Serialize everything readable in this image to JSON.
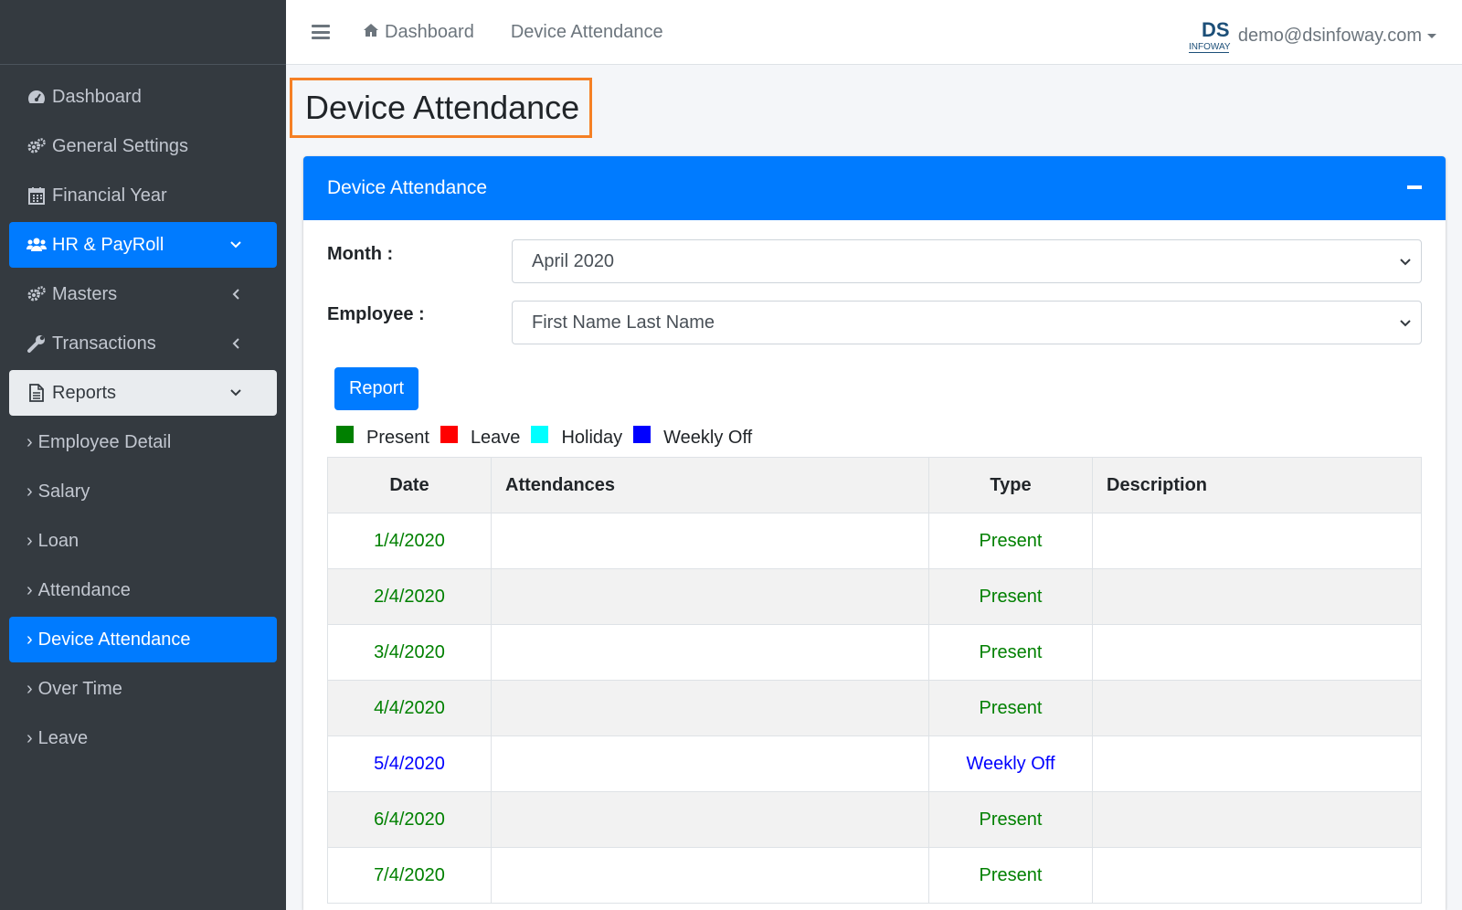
{
  "sidebar": {
    "items": [
      {
        "label": "Dashboard",
        "icon": "dashboard-icon"
      },
      {
        "label": "General Settings",
        "icon": "gears-icon"
      },
      {
        "label": "Financial Year",
        "icon": "calendar-icon"
      },
      {
        "label": "HR & PayRoll",
        "icon": "users-icon"
      },
      {
        "label": "Masters",
        "icon": "gears-icon"
      },
      {
        "label": "Transactions",
        "icon": "wrench-icon"
      },
      {
        "label": "Reports",
        "icon": "file-icon"
      }
    ],
    "sub_items": [
      "Employee Detail",
      "Salary",
      "Loan",
      "Attendance",
      "Device Attendance",
      "Over Time",
      "Leave"
    ]
  },
  "topbar": {
    "links": [
      "Dashboard",
      "Device Attendance"
    ],
    "user_email": "demo@dsinfoway.com",
    "logo_text": "DS",
    "logo_sub": "INFOWAY"
  },
  "page": {
    "title": "Device Attendance"
  },
  "card": {
    "title": "Device Attendance",
    "month_label": "Month :",
    "month_value": "April 2020",
    "employee_label": "Employee :",
    "employee_value": "First Name Last Name",
    "report_button": "Report"
  },
  "legend": [
    {
      "label": "Present",
      "color": "#008000"
    },
    {
      "label": "Leave",
      "color": "#ff0000"
    },
    {
      "label": "Holiday",
      "color": "#00ffff"
    },
    {
      "label": "Weekly Off",
      "color": "#0000ff"
    }
  ],
  "table": {
    "headers": [
      "Date",
      "Attendances",
      "Type",
      "Description"
    ],
    "rows": [
      {
        "date": "1/4/2020",
        "attendances": "",
        "type": "Present",
        "description": ""
      },
      {
        "date": "2/4/2020",
        "attendances": "",
        "type": "Present",
        "description": ""
      },
      {
        "date": "3/4/2020",
        "attendances": "",
        "type": "Present",
        "description": ""
      },
      {
        "date": "4/4/2020",
        "attendances": "",
        "type": "Present",
        "description": ""
      },
      {
        "date": "5/4/2020",
        "attendances": "",
        "type": "Weekly Off",
        "description": ""
      },
      {
        "date": "6/4/2020",
        "attendances": "",
        "type": "Present",
        "description": ""
      },
      {
        "date": "7/4/2020",
        "attendances": "",
        "type": "Present",
        "description": ""
      }
    ]
  },
  "colors": {
    "primary": "#007bff",
    "sidebar_bg": "#343a40",
    "present": "#008000",
    "weekly_off": "#0000ff",
    "highlight_border": "#f58025"
  }
}
